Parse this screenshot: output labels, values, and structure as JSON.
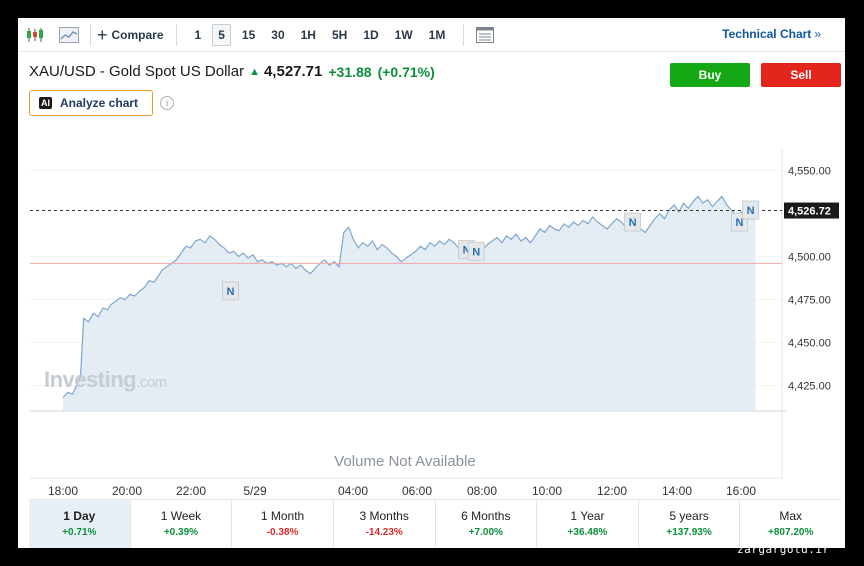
{
  "toolbar": {
    "compare_label": "Compare",
    "intervals": [
      "1",
      "5",
      "15",
      "30",
      "1H",
      "5H",
      "1D",
      "1W",
      "1M"
    ],
    "active_interval": "5",
    "technical_chart_label": "Technical Chart"
  },
  "instrument": {
    "name": "XAU/USD - Gold Spot US Dollar",
    "last": "4,527.71",
    "change": "+31.88",
    "change_pct": "(+0.71%)"
  },
  "actions": {
    "buy_label": "Buy",
    "sell_label": "Sell",
    "analyze_label": "Analyze chart",
    "ai_badge": "AI"
  },
  "colors": {
    "up": "#0a8f3a",
    "down": "#d62b2b",
    "buy": "#14a814",
    "sell": "#e3251c",
    "line": "#7fa6cf",
    "area": "#e4ecf4",
    "accent": "#1256a0"
  },
  "chart_data": {
    "type": "area",
    "y_ticks": [
      4425,
      4450,
      4475,
      4500,
      4550
    ],
    "y_tick_labels": [
      "4,425.00",
      "4,450.00",
      "4,475.00",
      "4,500.00",
      "4,550.00"
    ],
    "ylim": [
      4410,
      4555
    ],
    "x_tick_labels": [
      "18:00",
      "20:00",
      "22:00",
      "5/29",
      "04:00",
      "06:00",
      "08:00",
      "10:00",
      "12:00",
      "14:00",
      "16:00"
    ],
    "current_price": 4526.72,
    "current_price_label": "4,526.72",
    "prev_close": 4496,
    "news_marker_label": "N",
    "news_markers": [
      [
        10.5,
        4480
      ],
      [
        25.3,
        4504
      ],
      [
        25.9,
        4503
      ],
      [
        35.7,
        4520
      ],
      [
        42.4,
        4520
      ],
      [
        43.1,
        4527
      ]
    ],
    "volume_text": "Volume Not Available",
    "watermark_brand": "Investing",
    "watermark_suffix": ".com",
    "points": [
      [
        0.0,
        4418
      ],
      [
        0.3,
        4421
      ],
      [
        0.6,
        4420
      ],
      [
        0.9,
        4426
      ],
      [
        1.1,
        4430
      ],
      [
        1.3,
        4464
      ],
      [
        1.6,
        4462
      ],
      [
        1.9,
        4467
      ],
      [
        2.2,
        4465
      ],
      [
        2.5,
        4470
      ],
      [
        2.8,
        4469
      ],
      [
        3.0,
        4472
      ],
      [
        3.3,
        4474
      ],
      [
        3.6,
        4476
      ],
      [
        3.9,
        4475
      ],
      [
        4.2,
        4478
      ],
      [
        4.5,
        4477
      ],
      [
        4.8,
        4480
      ],
      [
        5.1,
        4482
      ],
      [
        5.4,
        4486
      ],
      [
        5.7,
        4485
      ],
      [
        6.0,
        4489
      ],
      [
        6.2,
        4492
      ],
      [
        6.5,
        4494
      ],
      [
        6.8,
        4496
      ],
      [
        7.1,
        4498
      ],
      [
        7.4,
        4502
      ],
      [
        7.7,
        4506
      ],
      [
        8.0,
        4505
      ],
      [
        8.3,
        4509
      ],
      [
        8.6,
        4510
      ],
      [
        8.9,
        4508
      ],
      [
        9.2,
        4512
      ],
      [
        9.5,
        4510
      ],
      [
        9.8,
        4507
      ],
      [
        10.1,
        4505
      ],
      [
        10.4,
        4502
      ],
      [
        10.7,
        4503
      ],
      [
        11.0,
        4500
      ],
      [
        11.3,
        4502
      ],
      [
        11.6,
        4499
      ],
      [
        11.9,
        4501
      ],
      [
        12.2,
        4497
      ],
      [
        12.5,
        4498
      ],
      [
        12.8,
        4496
      ],
      [
        13.1,
        4497
      ],
      [
        13.4,
        4495
      ],
      [
        13.7,
        4496
      ],
      [
        14.0,
        4494
      ],
      [
        14.3,
        4496
      ],
      [
        14.6,
        4493
      ],
      [
        14.9,
        4495
      ],
      [
        15.2,
        4492
      ],
      [
        15.5,
        4490
      ],
      [
        15.8,
        4493
      ],
      [
        16.1,
        4496
      ],
      [
        16.4,
        4498
      ],
      [
        16.7,
        4495
      ],
      [
        17.0,
        4497
      ],
      [
        17.3,
        4494
      ],
      [
        17.6,
        4514
      ],
      [
        17.9,
        4517
      ],
      [
        18.2,
        4510
      ],
      [
        18.5,
        4505
      ],
      [
        18.8,
        4508
      ],
      [
        19.1,
        4506
      ],
      [
        19.4,
        4509
      ],
      [
        19.7,
        4504
      ],
      [
        20.0,
        4507
      ],
      [
        20.3,
        4505
      ],
      [
        20.6,
        4502
      ],
      [
        20.9,
        4500
      ],
      [
        21.2,
        4497
      ],
      [
        21.5,
        4499
      ],
      [
        21.8,
        4501
      ],
      [
        22.1,
        4503
      ],
      [
        22.4,
        4506
      ],
      [
        22.7,
        4504
      ],
      [
        23.0,
        4508
      ],
      [
        23.3,
        4506
      ],
      [
        23.6,
        4509
      ],
      [
        23.9,
        4507
      ],
      [
        24.2,
        4510
      ],
      [
        24.5,
        4508
      ],
      [
        24.8,
        4505
      ],
      [
        25.1,
        4502
      ],
      [
        25.4,
        4500
      ],
      [
        25.7,
        4499
      ],
      [
        26.0,
        4501
      ],
      [
        26.3,
        4504
      ],
      [
        26.6,
        4507
      ],
      [
        26.9,
        4509
      ],
      [
        27.2,
        4511
      ],
      [
        27.5,
        4508
      ],
      [
        27.8,
        4512
      ],
      [
        28.1,
        4510
      ],
      [
        28.4,
        4513
      ],
      [
        28.7,
        4509
      ],
      [
        29.0,
        4511
      ],
      [
        29.3,
        4508
      ],
      [
        29.6,
        4512
      ],
      [
        29.9,
        4516
      ],
      [
        30.2,
        4514
      ],
      [
        30.5,
        4518
      ],
      [
        30.8,
        4516
      ],
      [
        31.1,
        4515
      ],
      [
        31.4,
        4519
      ],
      [
        31.7,
        4517
      ],
      [
        32.0,
        4520
      ],
      [
        32.3,
        4518
      ],
      [
        32.6,
        4521
      ],
      [
        32.9,
        4519
      ],
      [
        33.2,
        4523
      ],
      [
        33.5,
        4520
      ],
      [
        33.8,
        4518
      ],
      [
        34.1,
        4516
      ],
      [
        34.4,
        4519
      ],
      [
        34.7,
        4522
      ],
      [
        35.0,
        4520
      ],
      [
        35.3,
        4517
      ],
      [
        35.6,
        4515
      ],
      [
        35.9,
        4518
      ],
      [
        36.2,
        4516
      ],
      [
        36.5,
        4514
      ],
      [
        36.8,
        4518
      ],
      [
        37.1,
        4522
      ],
      [
        37.4,
        4525
      ],
      [
        37.7,
        4522
      ],
      [
        38.0,
        4527
      ],
      [
        38.3,
        4530
      ],
      [
        38.6,
        4526
      ],
      [
        38.9,
        4531
      ],
      [
        39.2,
        4528
      ],
      [
        39.5,
        4532
      ],
      [
        39.8,
        4535
      ],
      [
        40.1,
        4531
      ],
      [
        40.4,
        4533
      ],
      [
        40.7,
        4529
      ],
      [
        41.0,
        4532
      ],
      [
        41.3,
        4535
      ],
      [
        41.6,
        4530
      ],
      [
        41.9,
        4527
      ],
      [
        42.2,
        4524
      ],
      [
        42.5,
        4526
      ],
      [
        42.8,
        4523
      ],
      [
        43.1,
        4527
      ],
      [
        43.4,
        4531
      ]
    ]
  },
  "periods": [
    {
      "label": "1 Day",
      "change": "+0.71%",
      "dir": "up",
      "active": true
    },
    {
      "label": "1 Week",
      "change": "+0.39%",
      "dir": "up",
      "active": false
    },
    {
      "label": "1 Month",
      "change": "-0.38%",
      "dir": "down",
      "active": false
    },
    {
      "label": "3 Months",
      "change": "-14.23%",
      "dir": "down",
      "active": false
    },
    {
      "label": "6 Months",
      "change": "+7.00%",
      "dir": "up",
      "active": false
    },
    {
      "label": "1 Year",
      "change": "+36.48%",
      "dir": "up",
      "active": false
    },
    {
      "label": "5 years",
      "change": "+137.93%",
      "dir": "up",
      "active": false
    },
    {
      "label": "Max",
      "change": "+807.20%",
      "dir": "up",
      "active": false
    }
  ],
  "site_watermark": "zargargold.ir"
}
